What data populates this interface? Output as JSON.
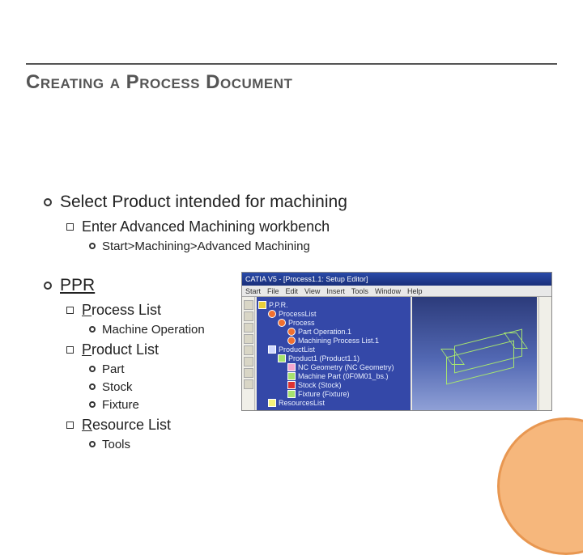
{
  "title": "Creating a Process Document",
  "bullets": {
    "select_product": "Select Product intended for machining",
    "enter_workbench": "Enter Advanced Machining workbench",
    "start_path": "Start>Machining>Advanced Machining",
    "ppr": "PPR",
    "process_list": "rocess List",
    "process_prefix": "P",
    "machine_op": "Machine Operation",
    "product_list": "roduct List",
    "product_prefix": "P",
    "part": "Part",
    "stock": "Stock",
    "fixture": "Fixture",
    "resource_list": "esource List",
    "resource_prefix": "R",
    "tools": "Tools"
  },
  "screenshot": {
    "window_title": "CATIA V5 - [Process1.1: Setup Editor]",
    "menus": [
      "Start",
      "File",
      "Edit",
      "View",
      "Insert",
      "Tools",
      "Window",
      "Help"
    ],
    "tree": [
      {
        "icon": "folder",
        "indent": 0,
        "label": "P.P.R."
      },
      {
        "icon": "gear",
        "indent": 1,
        "label": "ProcessList"
      },
      {
        "icon": "gear",
        "indent": 2,
        "label": "Process"
      },
      {
        "icon": "gear",
        "indent": 3,
        "label": "Part Operation.1"
      },
      {
        "icon": "gear",
        "indent": 3,
        "label": "Machining Process List.1"
      },
      {
        "icon": "part",
        "indent": 1,
        "label": "ProductList"
      },
      {
        "icon": "cube",
        "indent": 2,
        "label": "Product1 (Product1.1)"
      },
      {
        "icon": "pink",
        "indent": 3,
        "label": "NC Geometry (NC Geometry)"
      },
      {
        "icon": "cube",
        "indent": 3,
        "label": "Machine Part (0F0M01_bs.)"
      },
      {
        "icon": "red",
        "indent": 3,
        "label": "Stock (Stock)"
      },
      {
        "icon": "cube",
        "indent": 3,
        "label": "Fixture (Fixture)"
      },
      {
        "icon": "res",
        "indent": 1,
        "label": "ResourcesList"
      }
    ]
  }
}
